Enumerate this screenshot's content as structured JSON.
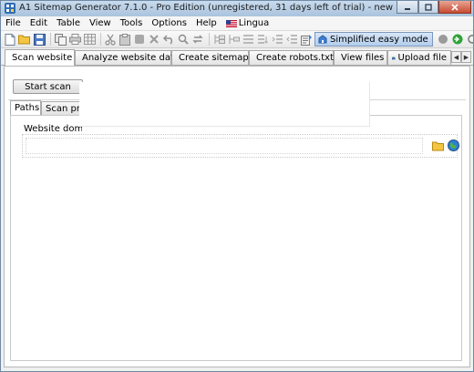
{
  "window": {
    "title": "A1 Sitemap Generator 7.1.0 - Pro Edition (unregistered, 31 days left of trial) - new project"
  },
  "menu": [
    "File",
    "Edit",
    "Table",
    "View",
    "Tools",
    "Options",
    "Help"
  ],
  "lingua": "Lingua",
  "toolbar": {
    "mode_label": "Simplified easy mode"
  },
  "tabs": [
    {
      "label": "Scan website",
      "icon": "scan-icon"
    },
    {
      "label": "Analyze website data",
      "icon": "analyze-icon"
    },
    {
      "label": "Create sitemap",
      "icon": "sitemap-icon"
    },
    {
      "label": "Create robots.txt",
      "icon": "robots-filter-icon"
    },
    {
      "label": "View files",
      "icon": "view-files-icon"
    },
    {
      "label": "Upload file",
      "icon": "upload-icon"
    }
  ],
  "scan": {
    "start_label": "Start scan",
    "subtabs": [
      "Paths",
      "Scan progress"
    ],
    "domain_label": "Website domain address:",
    "domain_value": ""
  }
}
